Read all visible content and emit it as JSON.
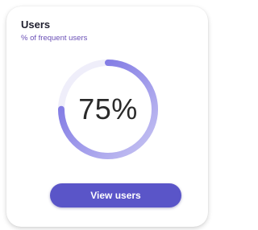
{
  "card": {
    "title": "Users",
    "subtitle": "% of frequent users"
  },
  "gauge": {
    "value_label": "75%",
    "fraction": 0.75,
    "track_color": "#efeefa",
    "arc_color_start": "#c9c6f3",
    "arc_color_end": "#6e66e0"
  },
  "actions": {
    "view_users_label": "View users"
  }
}
